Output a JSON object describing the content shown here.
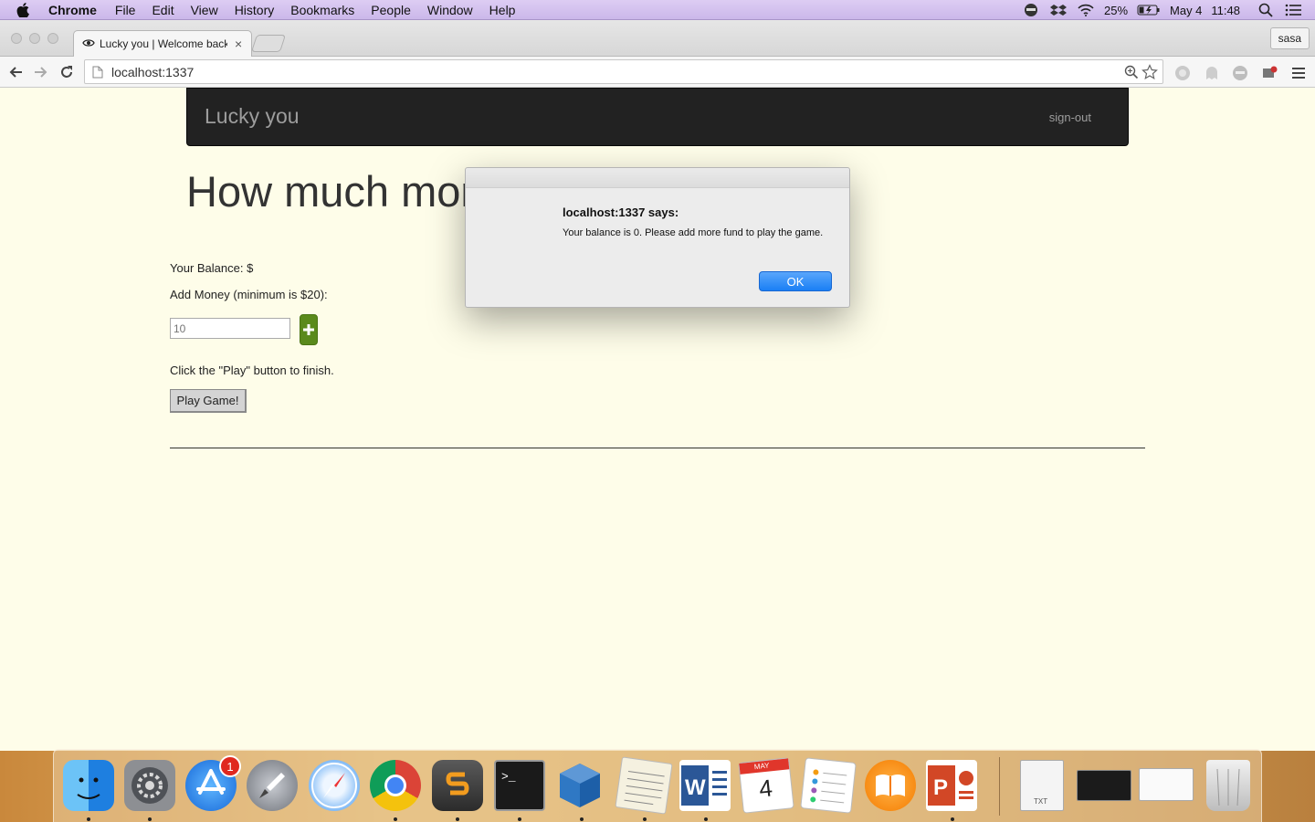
{
  "menubar": {
    "app_name": "Chrome",
    "items": [
      "File",
      "Edit",
      "View",
      "History",
      "Bookmarks",
      "People",
      "Window",
      "Help"
    ],
    "battery": "25%",
    "date": "May 4",
    "time": "11:48"
  },
  "browser": {
    "tab_title": "Lucky you | Welcome back",
    "profile_name": "sasa",
    "url": "localhost:1337"
  },
  "page": {
    "brand": "Lucky you",
    "signout": "sign-out",
    "heading": "How much mor",
    "balance_label": "Your Balance: $",
    "add_money_label": "Add Money (minimum is $20):",
    "money_placeholder": "10",
    "instruction": "Click the \"Play\" button to finish.",
    "play_button": "Play Game!"
  },
  "dialog": {
    "title": "localhost:1337 says:",
    "message": "Your balance is 0. Please add more fund to play the game.",
    "ok": "OK"
  },
  "dock": {
    "app_store_badge": "1",
    "calendar_month": "MAY",
    "calendar_day": "4",
    "file_label": "TXT"
  },
  "colors": {
    "page_bg": "#fefde9",
    "navbar_bg": "#222222",
    "plus_button": "#5a8a1c",
    "ok_button": "#1a7ff5",
    "menubar_bg": "#d6c6f0"
  }
}
